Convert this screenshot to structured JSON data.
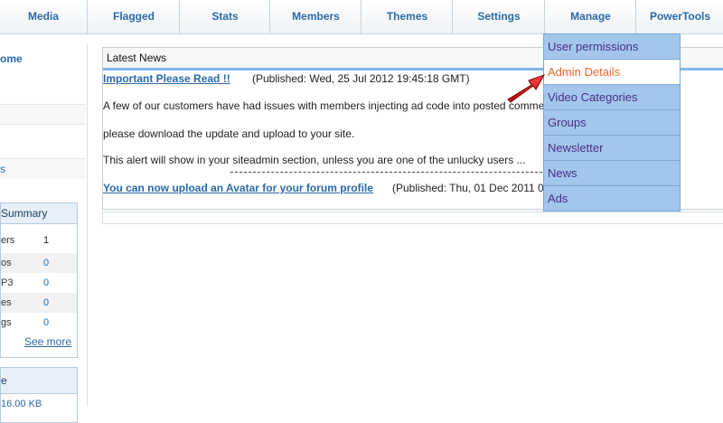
{
  "nav": {
    "items": [
      "Media",
      "Flagged",
      "Stats",
      "Members",
      "Themes",
      "Settings",
      "Manage",
      "PowerTools"
    ]
  },
  "sidebar": {
    "home": "ome",
    "row3_label": "s",
    "summary": {
      "title": "Summary",
      "rows": [
        {
          "label": "ers",
          "value": "1"
        },
        {
          "label": "os",
          "value": "0"
        },
        {
          "label": "P3",
          "value": "0"
        },
        {
          "label": "es",
          "value": "0"
        },
        {
          "label": "gs",
          "value": "0"
        }
      ],
      "see_more": "See more"
    },
    "box2": {
      "title": "e",
      "partial": "16.00 KB"
    }
  },
  "news": {
    "header": "Latest News",
    "item1": {
      "title": "Important Please Read !!",
      "published": "(Published: Wed, 25 Jul 2012 19:45:18 GMT)",
      "line1": "A few of our customers have had issues with members injecting ad code into posted comments or profile pages.",
      "line2": "please download the update and upload to your site.",
      "line3": "This alert will show in your siteadmin section, unless you are one of the unlucky users ..."
    },
    "item2": {
      "title": "You can now upload an Avatar for your forum profile",
      "published": "(Published: Thu, 01 Dec 2011 01:23:40 GMT)"
    }
  },
  "dropdown": {
    "items": [
      "User permissions",
      "Admin Details",
      "Video Categories",
      "Groups",
      "Newsletter",
      "News",
      "Ads"
    ],
    "active": "Admin Details"
  },
  "colors": {
    "link": "#2a6aa8",
    "dropdown_bg": "#a3c7ec",
    "dropdown_text": "#4b2d86",
    "active_text": "#ee6a2a",
    "arrow": "#e01515"
  }
}
